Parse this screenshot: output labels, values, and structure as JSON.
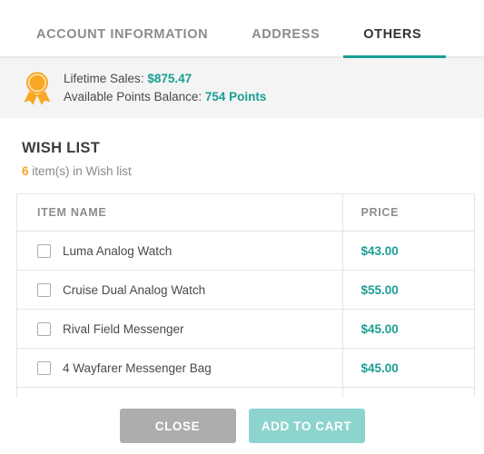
{
  "tabs": [
    {
      "label": "ACCOUNT INFORMATION",
      "active": false
    },
    {
      "label": "ADDRESS",
      "active": false
    },
    {
      "label": "OTHERS",
      "active": true
    }
  ],
  "banner": {
    "icon": "award-ribbon-icon",
    "lifetime_sales_label": "Lifetime Sales:",
    "lifetime_sales_value": "$875.47",
    "points_label": "Available Points Balance:",
    "points_value": "754 Points"
  },
  "wishlist": {
    "title": "WISH LIST",
    "count": "6",
    "count_suffix": " item(s) in Wish list",
    "columns": {
      "name": "ITEM NAME",
      "price": "PRICE"
    },
    "items": [
      {
        "name": "Luma Analog Watch",
        "price": "$43.00"
      },
      {
        "name": "Cruise Dual Analog Watch",
        "price": "$55.00"
      },
      {
        "name": "Rival Field Messenger",
        "price": "$45.00"
      },
      {
        "name": "4 Wayfarer Messenger Bag",
        "price": "$45.00"
      },
      {
        "name": "",
        "price": ""
      }
    ]
  },
  "footer": {
    "close_label": "CLOSE",
    "add_to_cart_label": "ADD TO CART"
  },
  "colors": {
    "teal": "#1a9f95",
    "teal_muted": "#8ed4ce",
    "orange": "#f5a623",
    "gray_button": "#adadad",
    "banner_bg": "#f4f4f4",
    "border": "#e4e4e4"
  }
}
